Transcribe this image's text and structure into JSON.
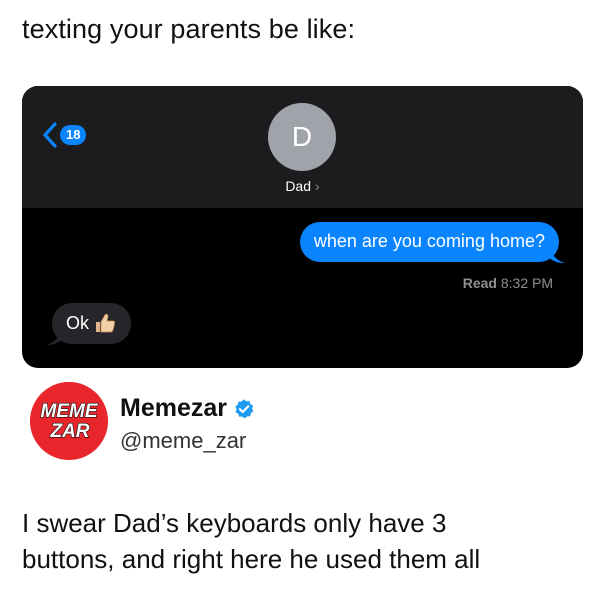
{
  "caption": "texting your parents be like:",
  "messages_screen": {
    "back_badge": "18",
    "contact_initial": "D",
    "contact_name": "Dad",
    "contact_chevron": "›",
    "sent_message": "when are you coming home?",
    "read_label": "Read",
    "read_time": "8:32 PM",
    "received_message": "Ok",
    "received_emoji": "thumbs-up-icon",
    "colors": {
      "sent_bubble": "#0a84ff",
      "received_bubble": "#26252a",
      "header_bg": "#1c1c1e",
      "screen_bg": "#000000"
    }
  },
  "tweet": {
    "avatar_line1": "MEME",
    "avatar_line2": "ZAR",
    "display_name": "Memezar",
    "verified_icon": "verified-badge-icon",
    "handle": "@meme_zar",
    "text_line1": "I swear Dad’s keyboards only have 3",
    "text_line2": "buttons, and right here he used them all",
    "avatar_color": "#e8262c"
  }
}
